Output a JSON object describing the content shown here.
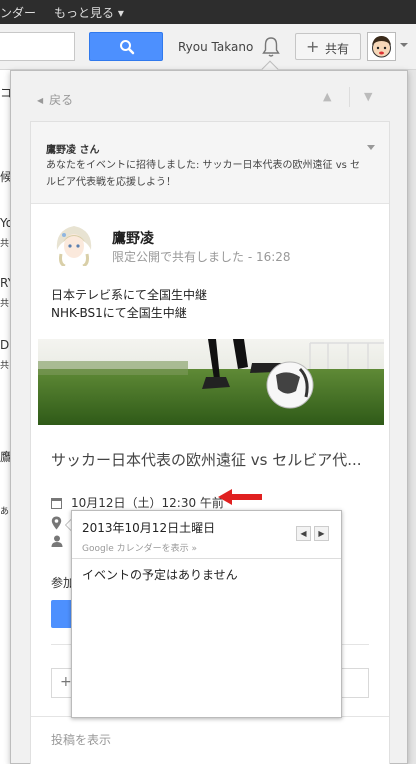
{
  "topbar": {
    "left_fragment": "ンダー",
    "more_label": "もっと見る ▾"
  },
  "header": {
    "username": "Ryou Takano",
    "share_label": "共有",
    "share_plus": "+"
  },
  "background_fragments": [
    "コ",
    "候",
    "Yo",
    "共",
    "RY",
    "共",
    "Da",
    "共",
    "鷹",
    "あ"
  ],
  "panel": {
    "back_label": "戻る",
    "back_arrow": "◀",
    "nav_up": "▲",
    "nav_down": "▼"
  },
  "notification": {
    "sender": "鷹野凌 さん",
    "message": "あなたをイベントに招待しました: サッカー日本代表の欧州遠征 vs セルビア代表戦を応援しよう！"
  },
  "post": {
    "author": "鷹野凌",
    "meta": "限定公開で共有しました  -  16:28",
    "lines": [
      "日本テレビ系にて全国生中継",
      "NHK-BS1にて全国生中継"
    ]
  },
  "event": {
    "title": "サッカー日本代表の欧州遠征 vs セルビア代...",
    "date": "10月12日（土）12:30 午前",
    "join_label": "参加",
    "comment_plus": "+",
    "show_post": "投稿を表示"
  },
  "calendar_popup": {
    "date": "2013年10月12日土曜日",
    "link": "Google カレンダーを表示 »",
    "prev": "◀",
    "next": "▶",
    "empty_message": "イベントの予定はありません"
  },
  "colors": {
    "accent_blue": "#4d90fe",
    "topbar": "#2d2d2d",
    "arrow_red": "#e02020"
  }
}
